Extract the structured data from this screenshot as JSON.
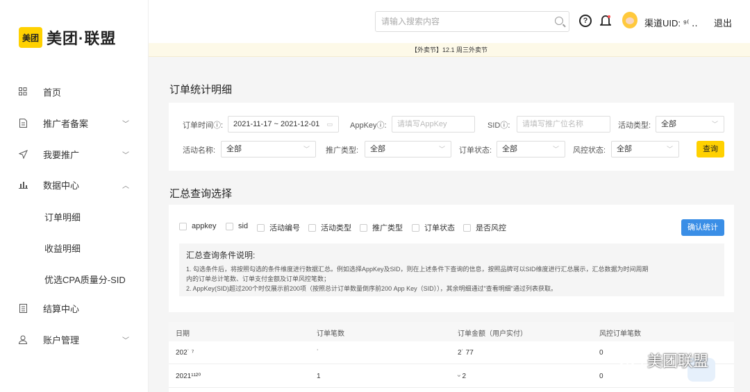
{
  "brand": {
    "badge": "美团",
    "name": "美团·联盟"
  },
  "sidebar": {
    "items": [
      {
        "label": "首页",
        "icon": "grid-icon"
      },
      {
        "label": "推广者备案",
        "icon": "doc-icon"
      },
      {
        "label": "我要推广",
        "icon": "send-icon"
      },
      {
        "label": "数据中心",
        "icon": "bar-chart-icon"
      },
      {
        "label": "结算中心",
        "icon": "file-icon"
      },
      {
        "label": "账户管理",
        "icon": "user-icon"
      }
    ],
    "subitems": [
      "订单明细",
      "收益明细",
      "优选CPA质量分-SID"
    ]
  },
  "header": {
    "search_placeholder": "请输入搜索内容",
    "help": "?",
    "uid_label": "渠道UID: ⁹⁽  ‥",
    "logout": "退出"
  },
  "notice": "【外卖节】12.1 周三外卖节",
  "filters": {
    "title": "订单统计明细",
    "order_time_label": "订单时间ⓘ:",
    "order_time_value": "2021-11-17 ~ 2021-12-01",
    "appkey_label": "AppKeyⓘ:",
    "appkey_placeholder": "请填写AppKey",
    "sid_label": "SIDⓘ:",
    "sid_placeholder": "请填写推广位名称",
    "activity_type_label": "活动类型:",
    "activity_type_value": "全部",
    "activity_name_label": "活动名称:",
    "activity_name_value": "全部",
    "promo_type_label": "推广类型:",
    "promo_type_value": "全部",
    "order_status_label": "订单状态:",
    "order_status_value": "全部",
    "risk_status_label": "风控状态:",
    "risk_status_value": "全部",
    "query_button": "查询"
  },
  "summary": {
    "title": "汇总查询选择",
    "checkboxes": [
      "appkey",
      "sid",
      "活动编号",
      "活动类型",
      "推广类型",
      "订单状态",
      "是否风控"
    ],
    "confirm_button": "确认统计",
    "desc_title": "汇总查询条件说明:",
    "desc_lines": [
      "1. 勾选条件后，将按照勾选的条件维度进行数据汇总。例如选择AppKey及SID，则在上述条件下查询的信息，按照品牌可以SID维度进行汇总展示，汇总数据为时间周期",
      "内的订单总计笔数、订单支付金额及订单风控笔数；",
      "2. AppKey(SID)超过200个时仅展示前200项（按照总计订单数量倒序前200 App Key（SID）），其余明细通过\"查看明细\"通过列表获取。"
    ]
  },
  "table": {
    "headers": [
      "日期",
      "订单笔数",
      "订单金额（用户实付）",
      "风控订单笔数"
    ],
    "rows": [
      [
        "202˙  ⁷",
        "˙",
        "2˙ 77",
        "0"
      ],
      [
        "2021¹¹²⁰",
        "1",
        "ᵕ 2",
        "0"
      ]
    ]
  },
  "watermark": "美团联盟"
}
